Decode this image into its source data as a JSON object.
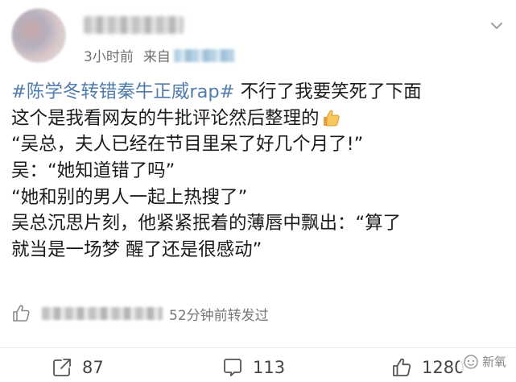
{
  "post": {
    "time": "3小时前",
    "source_prefix": "来自",
    "hashtag": "#陈学冬转错秦牛正威rap#",
    "lines": [
      " 不行了我要笑死了下面",
      "这个是我看网友的牛批评论然后整理的",
      "“吴总，夫人已经在节目里呆了好几个月了!”",
      "吴：“她知道错了吗”",
      "“她和别的男人一起上热搜了”",
      "吴总沉思片刻，他紧紧抿着的薄唇中飘出：“算了",
      "就当是一场梦 醒了还是很感动”"
    ],
    "repost_time": "52分钟前转发过"
  },
  "actions": {
    "repost_count": "87",
    "comment_count": "113",
    "like_count": "1280"
  },
  "watermark": {
    "text": "新氧"
  },
  "icons": {
    "more": "chevron-down-icon",
    "thumb": "thumbs-up-emoji",
    "repost": "share-icon",
    "comment": "comment-icon",
    "like": "thumbs-up-icon",
    "watermark": "xinyang-logo-icon"
  },
  "colors": {
    "hashtag": "#4f7cac",
    "meta": "#6f6f6f"
  }
}
